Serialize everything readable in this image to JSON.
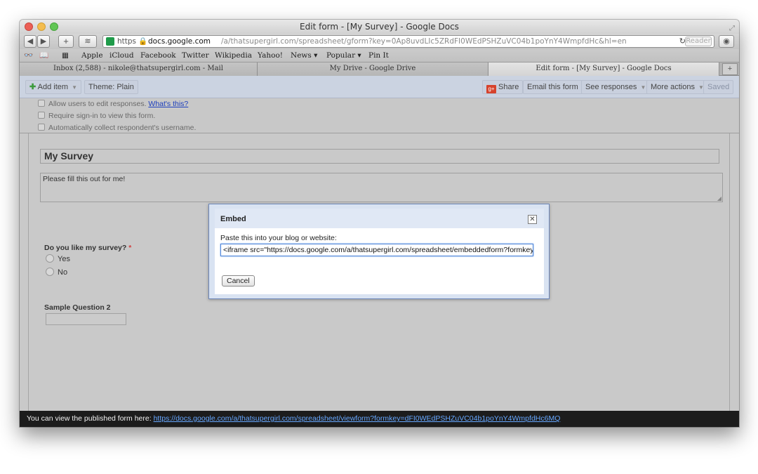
{
  "window": {
    "title": "Edit form - [My Survey] - Google Docs"
  },
  "toolbar": {
    "back_icon": "back-arrow-icon",
    "forward_icon": "forward-arrow-icon",
    "url_https": "https",
    "url_domain": "docs.google.com",
    "url_path": "/a/thatsupergirl.com/spreadsheet/gform?key=0Ap8uvdLIc5ZRdFI0WEdPSHZuVC04b1poYnY4WmpfdHc&hl=en",
    "reader_label": "Reader"
  },
  "bookmarks": [
    "Apple",
    "iCloud",
    "Facebook",
    "Twitter",
    "Wikipedia",
    "Yahoo!",
    "News ▾",
    "Popular ▾",
    "Pin It"
  ],
  "tabs": [
    {
      "label": "Inbox (2,588) - nikole@thatsupergirl.com - Mail"
    },
    {
      "label": "My Drive - Google Drive"
    },
    {
      "label": "Edit form - [My Survey] - Google Docs"
    }
  ],
  "form_toolbar": {
    "add_item": "Add item",
    "theme": "Theme: Plain",
    "share": "Share",
    "email": "Email this form",
    "see_responses": "See responses",
    "more_actions": "More actions",
    "saved": "Saved"
  },
  "settings": {
    "allow_edit": "Allow users to edit responses.",
    "whats_this": "What's this?",
    "require_signin": "Require sign-in to view this form.",
    "collect_username": "Automatically collect respondent's username."
  },
  "form": {
    "title": "My Survey",
    "description": "Please fill this out for me!",
    "question1": {
      "title": "Do you like my survey?",
      "required_mark": "*",
      "options": [
        "Yes",
        "No"
      ]
    },
    "question2": {
      "title": "Sample Question 2"
    }
  },
  "modal": {
    "title": "Embed",
    "label": "Paste this into your blog or website:",
    "embed_code": "<iframe src=\"https://docs.google.com/a/thatsupergirl.com/spreadsheet/embeddedform?formkey=",
    "cancel": "Cancel"
  },
  "footer": {
    "text": "You can view the published form here:",
    "link": "https://docs.google.com/a/thatsupergirl.com/spreadsheet/viewform?formkey=dFI0WEdPSHZuVC04b1poYnY4WmpfdHc6MQ"
  }
}
